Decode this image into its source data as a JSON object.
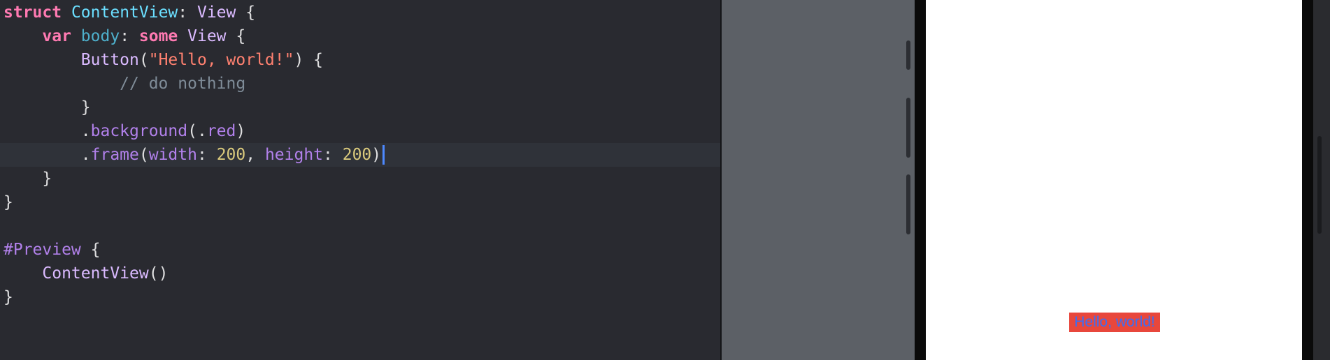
{
  "editor": {
    "lines": [
      [
        [
          "kw",
          "struct"
        ],
        [
          "plain",
          " "
        ],
        [
          "type-decl",
          "ContentView"
        ],
        [
          "plain",
          ": "
        ],
        [
          "type",
          "View"
        ],
        [
          "plain",
          " {"
        ]
      ],
      [
        [
          "plain",
          "    "
        ],
        [
          "kw",
          "var"
        ],
        [
          "plain",
          " "
        ],
        [
          "prop-decl",
          "body"
        ],
        [
          "plain",
          ": "
        ],
        [
          "kw",
          "some"
        ],
        [
          "plain",
          " "
        ],
        [
          "type",
          "View"
        ],
        [
          "plain",
          " {"
        ]
      ],
      [
        [
          "plain",
          "        "
        ],
        [
          "call",
          "Button"
        ],
        [
          "plain",
          "("
        ],
        [
          "str",
          "\"Hello, world!\""
        ],
        [
          "plain",
          ") {"
        ]
      ],
      [
        [
          "plain",
          "            "
        ],
        [
          "comment",
          "// do nothing"
        ]
      ],
      [
        [
          "plain",
          "        }"
        ]
      ],
      [
        [
          "plain",
          "        ."
        ],
        [
          "member",
          "background"
        ],
        [
          "plain",
          "(."
        ],
        [
          "member",
          "red"
        ],
        [
          "plain",
          ")"
        ]
      ],
      [
        [
          "plain",
          "        ."
        ],
        [
          "member",
          "frame"
        ],
        [
          "plain",
          "("
        ],
        [
          "member",
          "width"
        ],
        [
          "plain",
          ": "
        ],
        [
          "num",
          "200"
        ],
        [
          "plain",
          ", "
        ],
        [
          "member",
          "height"
        ],
        [
          "plain",
          ": "
        ],
        [
          "num",
          "200"
        ],
        [
          "plain",
          ")"
        ]
      ],
      [
        [
          "plain",
          "    }"
        ]
      ],
      [
        [
          "plain",
          "}"
        ]
      ],
      [],
      [
        [
          "macro",
          "#Preview"
        ],
        [
          "plain",
          " {"
        ]
      ],
      [
        [
          "plain",
          "    "
        ],
        [
          "call",
          "ContentView"
        ],
        [
          "plain",
          "()"
        ]
      ],
      [
        [
          "plain",
          "}"
        ]
      ]
    ],
    "current_line_index": 6
  },
  "preview": {
    "button_label": "Hello, world!",
    "button_background": "#e8473c",
    "button_text_color": "#3b6ef5"
  },
  "colors": {
    "editor_background": "#292a30",
    "current_line": "#2f3239",
    "canvas_background": "#5c6066",
    "device_screen": "#ffffff",
    "caret": "#4d89ff"
  }
}
